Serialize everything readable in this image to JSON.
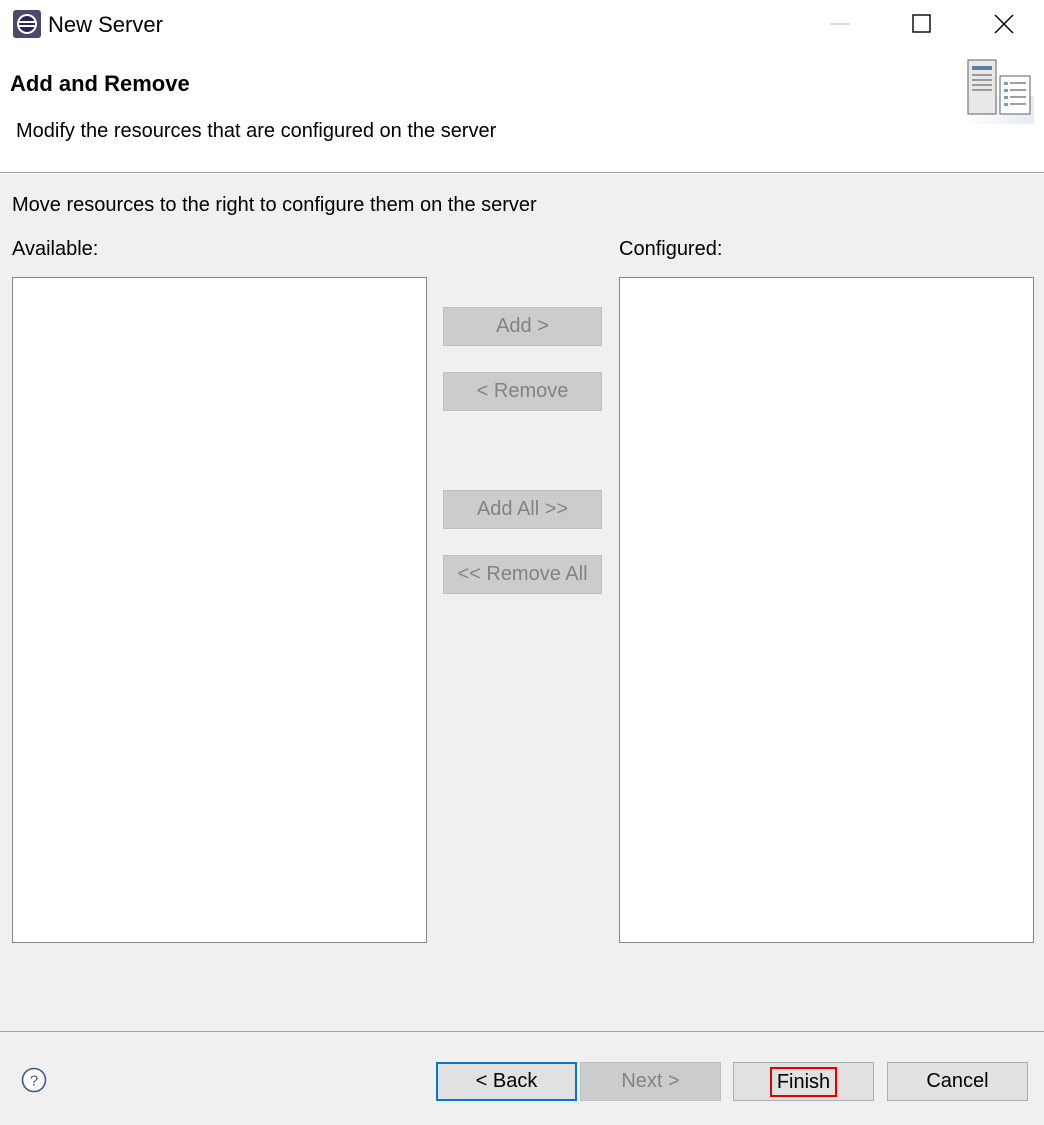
{
  "window": {
    "title": "New Server",
    "app_icon": "eclipse-icon",
    "controls": {
      "minimize_icon": "minimize-icon",
      "maximize_icon": "maximize-icon",
      "close_icon": "close-icon"
    }
  },
  "banner": {
    "title": "Add and Remove",
    "description": "Modify the resources that are configured on the server",
    "graphic_icon": "server-wizard-icon"
  },
  "main": {
    "instruction": "Move resources to the right to configure them on the server",
    "available_label": "Available:",
    "configured_label": "Configured:",
    "available_items": [],
    "configured_items": [],
    "buttons": {
      "add": "Add >",
      "remove": "< Remove",
      "add_all": "Add All >>",
      "remove_all": "<< Remove All"
    }
  },
  "footer": {
    "help_icon": "help-icon",
    "back": "< Back",
    "next": "Next >",
    "finish": "Finish",
    "cancel": "Cancel"
  },
  "colors": {
    "dialog_background": "#f0f0f0",
    "disabled_button": "#cccccc",
    "disabled_text": "#838383",
    "focus_border": "#0078d7",
    "highlight_border": "#e00000"
  }
}
